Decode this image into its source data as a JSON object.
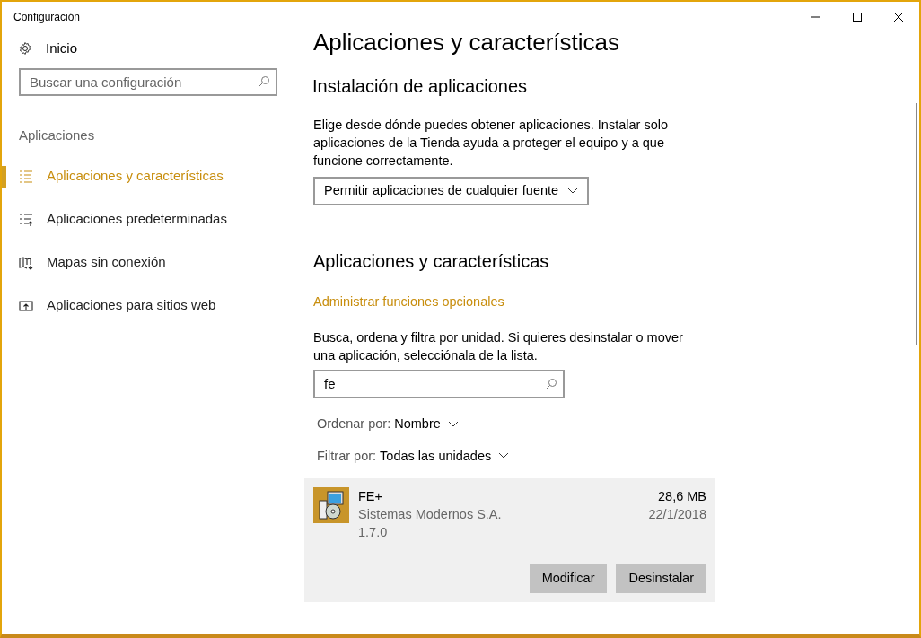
{
  "window": {
    "title": "Configuración"
  },
  "sidebar": {
    "home": "Inicio",
    "search": {
      "placeholder": "Buscar una configuración"
    },
    "section": "Aplicaciones",
    "items": [
      {
        "label": "Aplicaciones y características",
        "kind": "list",
        "selected": true
      },
      {
        "label": "Aplicaciones predeterminadas",
        "kind": "defaults",
        "selected": false
      },
      {
        "label": "Mapas sin conexión",
        "kind": "map",
        "selected": false
      },
      {
        "label": "Aplicaciones para sitios web",
        "kind": "web",
        "selected": false
      }
    ]
  },
  "page": {
    "title": "Aplicaciones y características",
    "install": {
      "heading": "Instalación de aplicaciones",
      "description": "Elige desde dónde puedes obtener aplicaciones. Instalar solo aplicaciones de la Tienda ayuda a proteger el equipo y a que funcione correctamente.",
      "dropdown": "Permitir aplicaciones de cualquier fuente"
    },
    "apps": {
      "heading": "Aplicaciones y características",
      "link": "Administrar funciones opcionales",
      "description": "Busca, ordena y filtra por unidad. Si quieres desinstalar o mover una aplicación, selecciónala de la lista.",
      "search": {
        "value": "fe"
      },
      "sort": {
        "label": "Ordenar por:",
        "value": "Nombre"
      },
      "filter": {
        "label": "Filtrar por:",
        "value": "Todas las unidades"
      },
      "list": [
        {
          "name": "FE+",
          "publisher": "Sistemas Modernos S.A.",
          "version": "1.7.0",
          "size": "28,6 MB",
          "date": "22/1/2018",
          "selected": true,
          "buttons": [
            "Modificar",
            "Desinstalar"
          ]
        }
      ]
    }
  }
}
